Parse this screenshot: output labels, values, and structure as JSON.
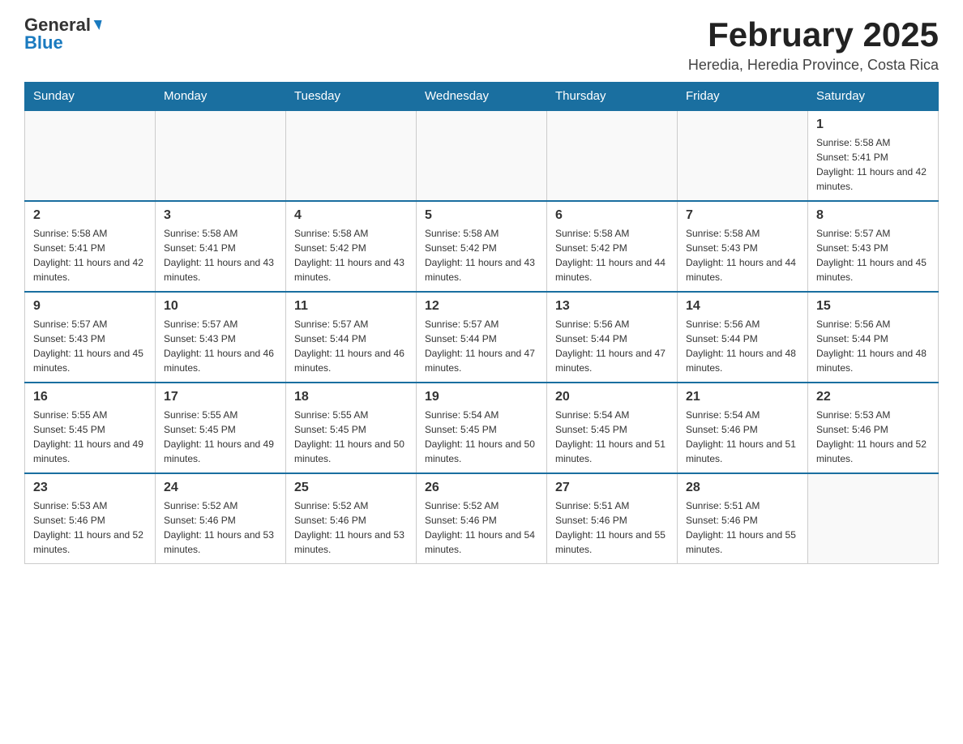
{
  "header": {
    "logo_general": "General",
    "logo_blue": "Blue",
    "month_title": "February 2025",
    "location": "Heredia, Heredia Province, Costa Rica"
  },
  "weekdays": [
    "Sunday",
    "Monday",
    "Tuesday",
    "Wednesday",
    "Thursday",
    "Friday",
    "Saturday"
  ],
  "weeks": [
    [
      {
        "day": "",
        "info": ""
      },
      {
        "day": "",
        "info": ""
      },
      {
        "day": "",
        "info": ""
      },
      {
        "day": "",
        "info": ""
      },
      {
        "day": "",
        "info": ""
      },
      {
        "day": "",
        "info": ""
      },
      {
        "day": "1",
        "info": "Sunrise: 5:58 AM\nSunset: 5:41 PM\nDaylight: 11 hours and 42 minutes."
      }
    ],
    [
      {
        "day": "2",
        "info": "Sunrise: 5:58 AM\nSunset: 5:41 PM\nDaylight: 11 hours and 42 minutes."
      },
      {
        "day": "3",
        "info": "Sunrise: 5:58 AM\nSunset: 5:41 PM\nDaylight: 11 hours and 43 minutes."
      },
      {
        "day": "4",
        "info": "Sunrise: 5:58 AM\nSunset: 5:42 PM\nDaylight: 11 hours and 43 minutes."
      },
      {
        "day": "5",
        "info": "Sunrise: 5:58 AM\nSunset: 5:42 PM\nDaylight: 11 hours and 43 minutes."
      },
      {
        "day": "6",
        "info": "Sunrise: 5:58 AM\nSunset: 5:42 PM\nDaylight: 11 hours and 44 minutes."
      },
      {
        "day": "7",
        "info": "Sunrise: 5:58 AM\nSunset: 5:43 PM\nDaylight: 11 hours and 44 minutes."
      },
      {
        "day": "8",
        "info": "Sunrise: 5:57 AM\nSunset: 5:43 PM\nDaylight: 11 hours and 45 minutes."
      }
    ],
    [
      {
        "day": "9",
        "info": "Sunrise: 5:57 AM\nSunset: 5:43 PM\nDaylight: 11 hours and 45 minutes."
      },
      {
        "day": "10",
        "info": "Sunrise: 5:57 AM\nSunset: 5:43 PM\nDaylight: 11 hours and 46 minutes."
      },
      {
        "day": "11",
        "info": "Sunrise: 5:57 AM\nSunset: 5:44 PM\nDaylight: 11 hours and 46 minutes."
      },
      {
        "day": "12",
        "info": "Sunrise: 5:57 AM\nSunset: 5:44 PM\nDaylight: 11 hours and 47 minutes."
      },
      {
        "day": "13",
        "info": "Sunrise: 5:56 AM\nSunset: 5:44 PM\nDaylight: 11 hours and 47 minutes."
      },
      {
        "day": "14",
        "info": "Sunrise: 5:56 AM\nSunset: 5:44 PM\nDaylight: 11 hours and 48 minutes."
      },
      {
        "day": "15",
        "info": "Sunrise: 5:56 AM\nSunset: 5:44 PM\nDaylight: 11 hours and 48 minutes."
      }
    ],
    [
      {
        "day": "16",
        "info": "Sunrise: 5:55 AM\nSunset: 5:45 PM\nDaylight: 11 hours and 49 minutes."
      },
      {
        "day": "17",
        "info": "Sunrise: 5:55 AM\nSunset: 5:45 PM\nDaylight: 11 hours and 49 minutes."
      },
      {
        "day": "18",
        "info": "Sunrise: 5:55 AM\nSunset: 5:45 PM\nDaylight: 11 hours and 50 minutes."
      },
      {
        "day": "19",
        "info": "Sunrise: 5:54 AM\nSunset: 5:45 PM\nDaylight: 11 hours and 50 minutes."
      },
      {
        "day": "20",
        "info": "Sunrise: 5:54 AM\nSunset: 5:45 PM\nDaylight: 11 hours and 51 minutes."
      },
      {
        "day": "21",
        "info": "Sunrise: 5:54 AM\nSunset: 5:46 PM\nDaylight: 11 hours and 51 minutes."
      },
      {
        "day": "22",
        "info": "Sunrise: 5:53 AM\nSunset: 5:46 PM\nDaylight: 11 hours and 52 minutes."
      }
    ],
    [
      {
        "day": "23",
        "info": "Sunrise: 5:53 AM\nSunset: 5:46 PM\nDaylight: 11 hours and 52 minutes."
      },
      {
        "day": "24",
        "info": "Sunrise: 5:52 AM\nSunset: 5:46 PM\nDaylight: 11 hours and 53 minutes."
      },
      {
        "day": "25",
        "info": "Sunrise: 5:52 AM\nSunset: 5:46 PM\nDaylight: 11 hours and 53 minutes."
      },
      {
        "day": "26",
        "info": "Sunrise: 5:52 AM\nSunset: 5:46 PM\nDaylight: 11 hours and 54 minutes."
      },
      {
        "day": "27",
        "info": "Sunrise: 5:51 AM\nSunset: 5:46 PM\nDaylight: 11 hours and 55 minutes."
      },
      {
        "day": "28",
        "info": "Sunrise: 5:51 AM\nSunset: 5:46 PM\nDaylight: 11 hours and 55 minutes."
      },
      {
        "day": "",
        "info": ""
      }
    ]
  ]
}
